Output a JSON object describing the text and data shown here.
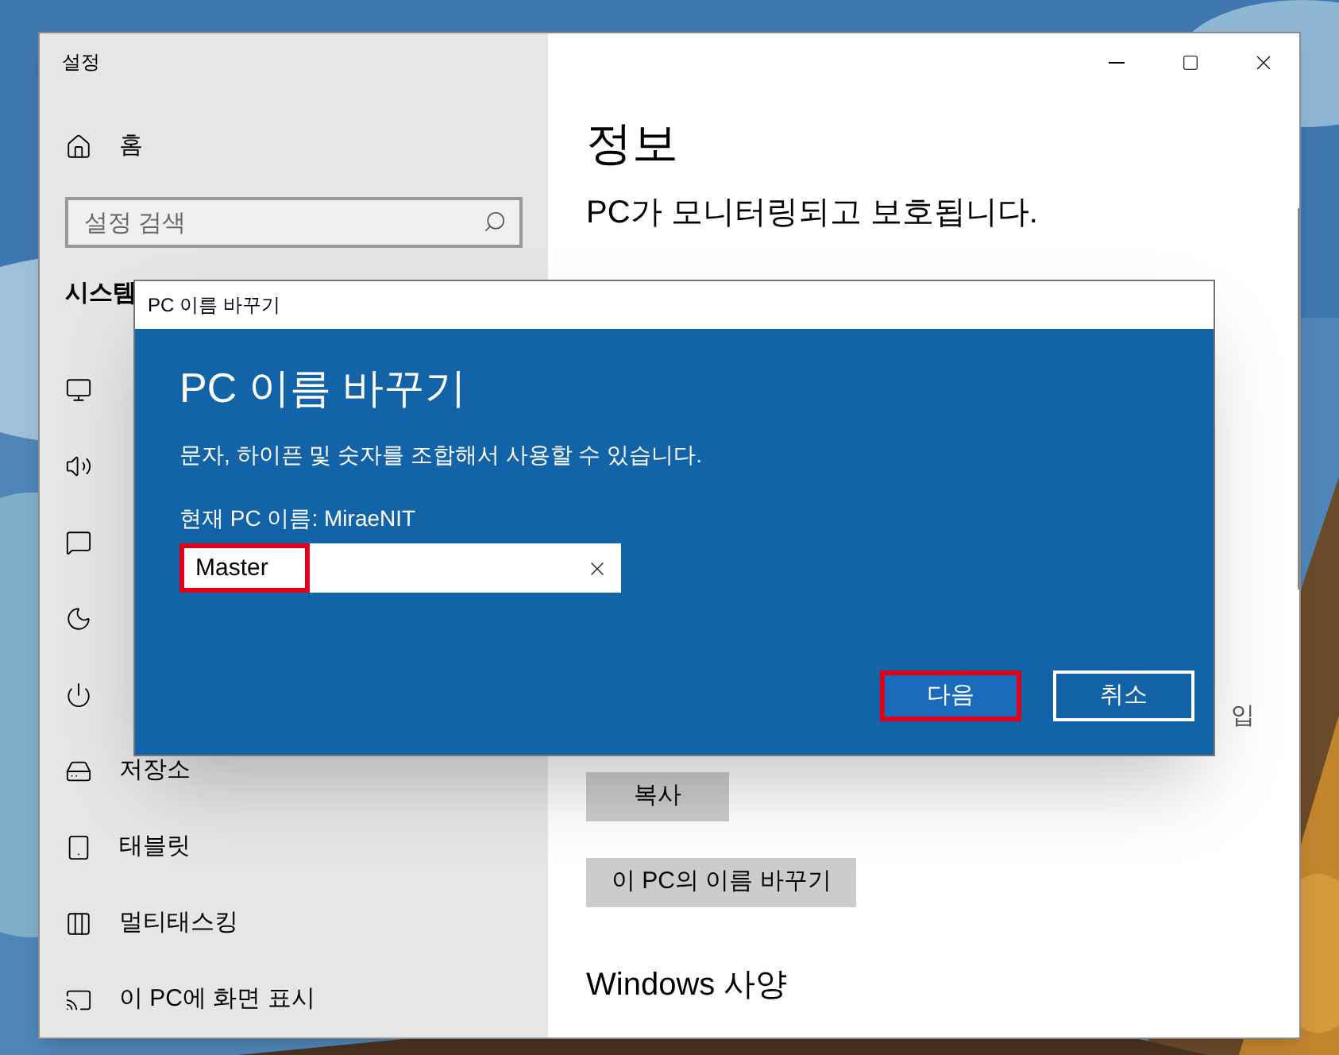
{
  "window": {
    "title": "설정"
  },
  "sidebar": {
    "home": "홈",
    "search": {
      "placeholder": "설정 검색"
    },
    "section": "시스템",
    "items": [
      {
        "kind": "covered"
      },
      {
        "kind": "covered"
      },
      {
        "kind": "covered"
      },
      {
        "kind": "covered"
      },
      {
        "kind": "covered"
      },
      {
        "kind": "item",
        "label": "저장소"
      },
      {
        "kind": "item",
        "label": "태블릿"
      },
      {
        "kind": "item",
        "label": "멀티태스킹"
      },
      {
        "kind": "item",
        "label": "이 PC에 화면 표시"
      }
    ]
  },
  "content": {
    "title": "정보",
    "subtitle": "PC가 모니터링되고 보호됩니다.",
    "partial_text": "입",
    "buttons": [
      "복사",
      "이 PC의 이름 바꾸기"
    ],
    "section": "Windows 사양"
  },
  "dialog": {
    "title": "PC 이름 바꾸기",
    "heading": "PC 이름 바꾸기",
    "description": "문자, 하이픈 및 숫자를 조합해서 사용할 수 있습니다.",
    "current_name": "현재 PC 이름: MiraeNIT",
    "name_field": {
      "value": "Master",
      "highlighted": true
    },
    "buttons": [
      {
        "label": "다음",
        "kind": "primary",
        "highlighted": true
      },
      {
        "label": "취소",
        "kind": "secondary",
        "highlighted": false
      }
    ]
  }
}
